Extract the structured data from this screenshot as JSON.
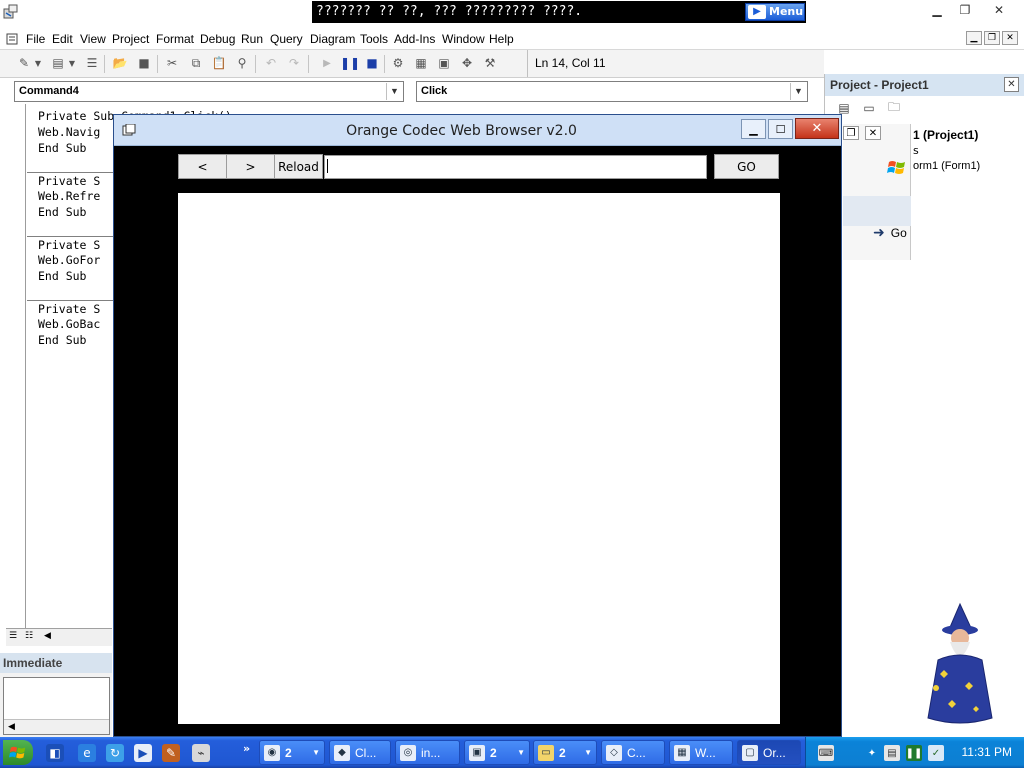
{
  "top": {
    "banner_text": "??????? ?? ??, ??? ????????? ????.",
    "menu_button": "Menu"
  },
  "menubar": {
    "items": [
      "File",
      "Edit",
      "View",
      "Project",
      "Format",
      "Debug",
      "Run",
      "Query",
      "Diagram",
      "Tools",
      "Add-Ins",
      "Window",
      "Help"
    ]
  },
  "toolbar": {
    "cursor_position": "Ln 14, Col 11"
  },
  "code": {
    "object_combo": "Command4",
    "procedure_combo": "Click",
    "lines": [
      "Private Sub Command1_Click()",
      "Web.Navig",
      "End Sub",
      "",
      "Private S",
      "Web.Refre",
      "End Sub",
      "",
      "Private S",
      "Web.GoFor",
      "End Sub",
      "",
      "Private S",
      "Web.GoBac",
      "End Sub"
    ]
  },
  "immediate": {
    "title": "Immediate"
  },
  "project": {
    "title": "Project - Project1",
    "tree_root": "1 (Project1)",
    "tree_folder": "s",
    "tree_form": "orm1 (Form1)",
    "go_label": "Go"
  },
  "browser": {
    "title": "Orange Codec Web Browser v2.0",
    "back_label": "<",
    "forward_label": ">",
    "reload_label": "Reload",
    "url_value": "",
    "go_label": "GO"
  },
  "taskbar": {
    "tasks": [
      {
        "label": "",
        "count": "2",
        "has_dropdown": true
      },
      {
        "label": "Cl...",
        "count": "",
        "has_dropdown": false
      },
      {
        "label": "in...",
        "count": "",
        "has_dropdown": false
      },
      {
        "label": "",
        "count": "2",
        "has_dropdown": true
      },
      {
        "label": "",
        "count": "2",
        "has_dropdown": true
      },
      {
        "label": "C...",
        "count": "",
        "has_dropdown": false
      },
      {
        "label": "W...",
        "count": "",
        "has_dropdown": false
      },
      {
        "label": "Or...",
        "count": "",
        "has_dropdown": false
      }
    ],
    "clock": "11:31 PM"
  },
  "colors": {
    "taskbar_blue": "#245edb",
    "tray_blue": "#0b83d8",
    "close_red": "#c4331a",
    "browser_bg": "#000000"
  }
}
